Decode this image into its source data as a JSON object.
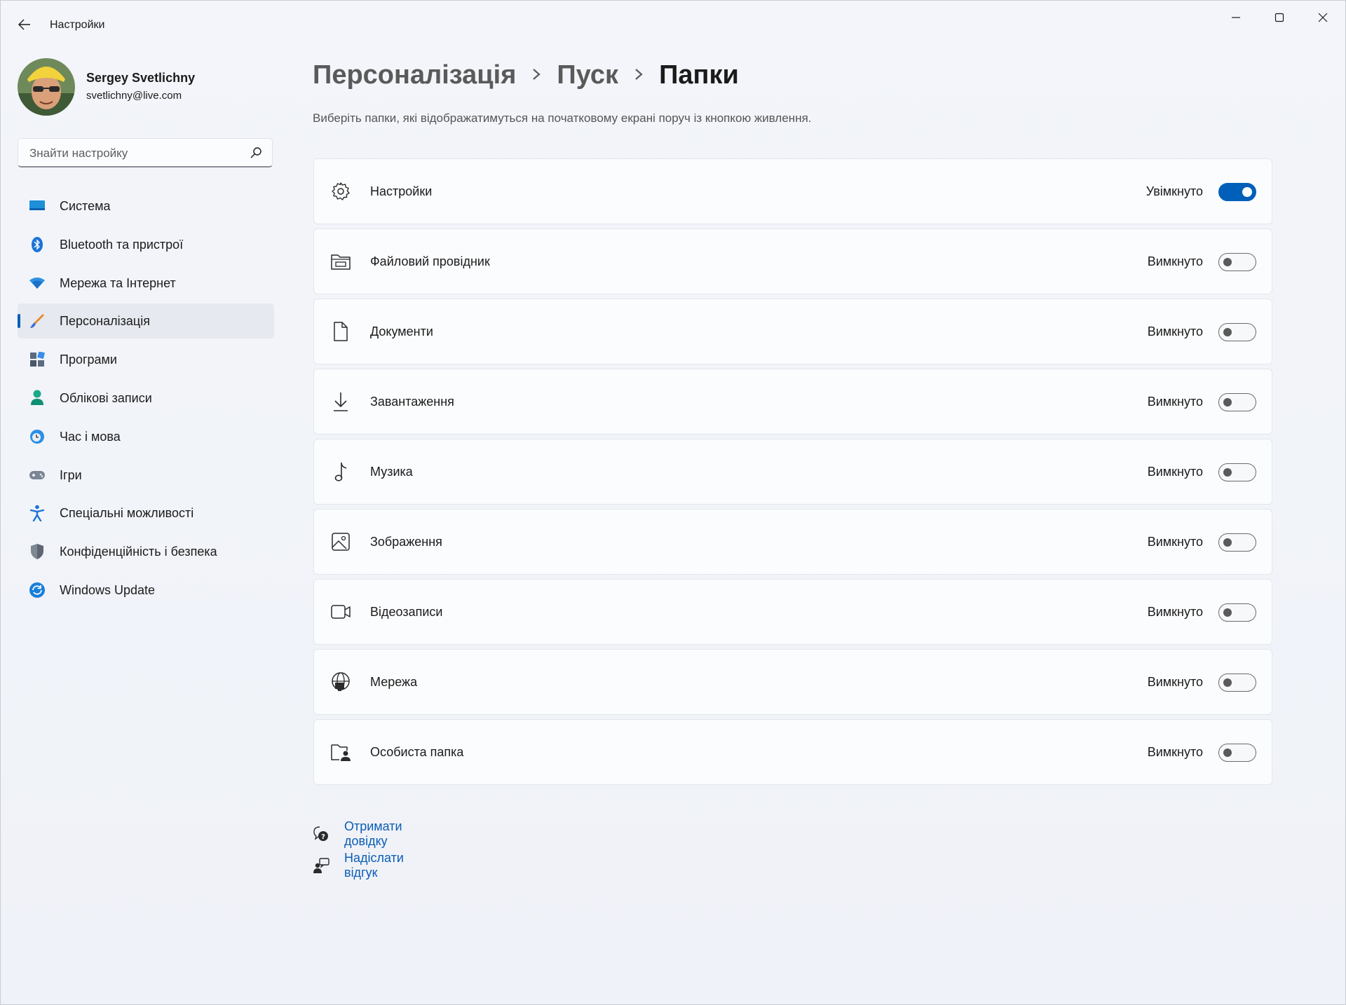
{
  "app": {
    "title": "Настройки"
  },
  "profile": {
    "name": "Sergey Svetlichny",
    "email": "svetlichny@live.com"
  },
  "search": {
    "placeholder": "Знайти настройку"
  },
  "sidebar": {
    "items": [
      {
        "label": "Система",
        "icon": "system-icon",
        "active": false
      },
      {
        "label": "Bluetooth та пристрої",
        "icon": "bluetooth-icon",
        "active": false
      },
      {
        "label": "Мережа та Інтернет",
        "icon": "wifi-icon",
        "active": false
      },
      {
        "label": "Персоналізація",
        "icon": "brush-icon",
        "active": true
      },
      {
        "label": "Програми",
        "icon": "apps-icon",
        "active": false
      },
      {
        "label": "Облікові записи",
        "icon": "account-icon",
        "active": false
      },
      {
        "label": "Час і мова",
        "icon": "time-language-icon",
        "active": false
      },
      {
        "label": "Ігри",
        "icon": "gamepad-icon",
        "active": false
      },
      {
        "label": "Спеціальні можливості",
        "icon": "accessibility-icon",
        "active": false
      },
      {
        "label": "Конфіденційність і безпека",
        "icon": "shield-icon",
        "active": false
      },
      {
        "label": "Windows Update",
        "icon": "update-icon",
        "active": false
      }
    ]
  },
  "breadcrumb": {
    "items": [
      "Персоналізація",
      "Пуск"
    ],
    "current": "Папки"
  },
  "main": {
    "subtitle": "Виберіть папки, які відображатимуться на початковому екрані поруч із кнопкою живлення.",
    "folders": [
      {
        "label": "Настройки",
        "icon": "gear-icon",
        "state": "Увімкнуто",
        "on": true
      },
      {
        "label": "Файловий провідник",
        "icon": "file-explorer-icon",
        "state": "Вимкнуто",
        "on": false
      },
      {
        "label": "Документи",
        "icon": "document-icon",
        "state": "Вимкнуто",
        "on": false
      },
      {
        "label": "Завантаження",
        "icon": "download-icon",
        "state": "Вимкнуто",
        "on": false
      },
      {
        "label": "Музика",
        "icon": "music-icon",
        "state": "Вимкнуто",
        "on": false
      },
      {
        "label": "Зображення",
        "icon": "picture-icon",
        "state": "Вимкнуто",
        "on": false
      },
      {
        "label": "Відеозаписи",
        "icon": "video-icon",
        "state": "Вимкнуто",
        "on": false
      },
      {
        "label": "Мережа",
        "icon": "network-icon",
        "state": "Вимкнуто",
        "on": false
      },
      {
        "label": "Особиста папка",
        "icon": "personal-folder-icon",
        "state": "Вимкнуто",
        "on": false
      }
    ]
  },
  "links": {
    "help": "Отримати довідку",
    "feedback": "Надіслати відгук"
  },
  "colors": {
    "accent": "#005fb8",
    "link": "#0a5db5",
    "background": "#f0f3f9",
    "card": "#fbfcfe"
  }
}
